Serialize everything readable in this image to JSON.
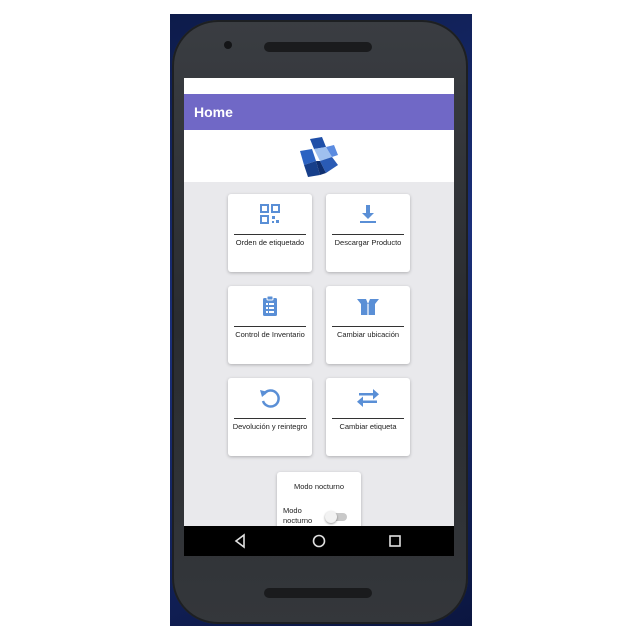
{
  "appbar": {
    "title": "Home"
  },
  "logo": {
    "icon": "cube-logo-icon"
  },
  "menu": {
    "items": [
      {
        "label": "Orden de etiquetado",
        "icon": "qr-code-icon"
      },
      {
        "label": "Descargar Producto",
        "icon": "download-icon"
      },
      {
        "label": "Control de Inventario",
        "icon": "clipboard-list-icon"
      },
      {
        "label": "Cambiar ubicación",
        "icon": "open-box-icon"
      },
      {
        "label": "Devolución y reintegro",
        "icon": "undo-icon"
      },
      {
        "label": "Cambiar etiqueta",
        "icon": "swap-icon"
      }
    ]
  },
  "night_mode": {
    "title": "Modo nocturno",
    "toggle_label": "Modo nocturno",
    "enabled": false
  },
  "colors": {
    "appbar": "#7068c6",
    "icon_blue": "#5a8fd6",
    "logo_blue": "#1f4fa8"
  },
  "navbar": {
    "back": "back-icon",
    "home": "home-icon",
    "recents": "recents-icon"
  }
}
